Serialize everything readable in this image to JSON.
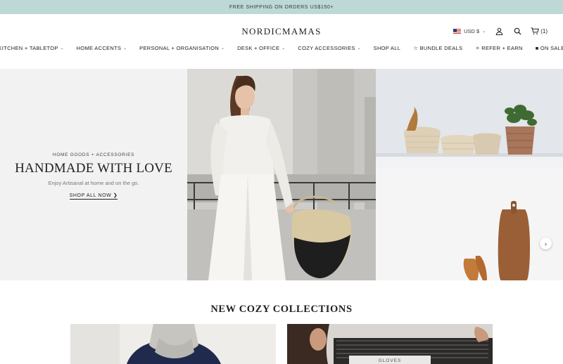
{
  "promo": {
    "text": "FREE SHIPPING ON ORDERS US$150+"
  },
  "header": {
    "logo": "NORDICMAMAS",
    "currency": "USD $",
    "cart_count": "(1)"
  },
  "nav": {
    "items": [
      {
        "label": "KITCHEN + TABLETOP",
        "has_dropdown": true
      },
      {
        "label": "HOME ACCENTS",
        "has_dropdown": true
      },
      {
        "label": "PERSONAL + ORGANISATION",
        "has_dropdown": true
      },
      {
        "label": "DESK + OFFICE",
        "has_dropdown": true
      },
      {
        "label": "COZY ACCESSORIES",
        "has_dropdown": true
      },
      {
        "label": "SHOP ALL",
        "has_dropdown": false
      },
      {
        "label": "☆ BUNDLE DEALS",
        "has_dropdown": false
      },
      {
        "label": "✧ REFER + EARN",
        "has_dropdown": false
      },
      {
        "label": "■ ON SALE",
        "has_dropdown": false
      }
    ]
  },
  "hero": {
    "eyebrow": "HOME GOODS + ACCESSORIES",
    "title": "HANDMADE WITH LOVE",
    "subtitle": "Enjoy Artisanal at home and on the go.",
    "cta": "SHOP ALL NOW ❯"
  },
  "collections": {
    "title": "NEW COZY COLLECTIONS",
    "cards": [
      {
        "label": ""
      },
      {
        "label": "GLOVES"
      }
    ]
  },
  "colors": {
    "promo_bg": "#bcd9d6",
    "hero_panel_bg": "#f2f2f2",
    "text": "#222222"
  }
}
